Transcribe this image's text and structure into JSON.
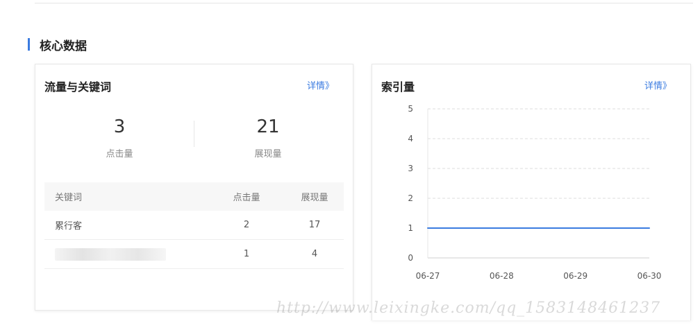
{
  "section": {
    "title": "核心数据"
  },
  "traffic_card": {
    "title": "流量与关键词",
    "detail_link": "详情》",
    "stats": [
      {
        "value": "3",
        "label": "点击量"
      },
      {
        "value": "21",
        "label": "展现量"
      }
    ],
    "table": {
      "headers": [
        "关键词",
        "点击量",
        "展现量"
      ],
      "rows": [
        {
          "keyword": "累行客",
          "clicks": "2",
          "impressions": "17"
        },
        {
          "keyword": "",
          "clicks": "1",
          "impressions": "4"
        }
      ]
    }
  },
  "index_card": {
    "title": "索引量",
    "detail_link": "详情》"
  },
  "chart_data": {
    "type": "line",
    "categories": [
      "06-27",
      "06-28",
      "06-29",
      "06-30"
    ],
    "series": [
      {
        "values": [
          1,
          1,
          1,
          1
        ]
      }
    ],
    "ylim": [
      0,
      5
    ],
    "yticks": [
      0,
      1,
      2,
      3,
      4,
      5
    ],
    "grid": true,
    "line_color": "#3a7be0"
  },
  "watermark": "http://www.leixingke.com/qq_1583148461237"
}
